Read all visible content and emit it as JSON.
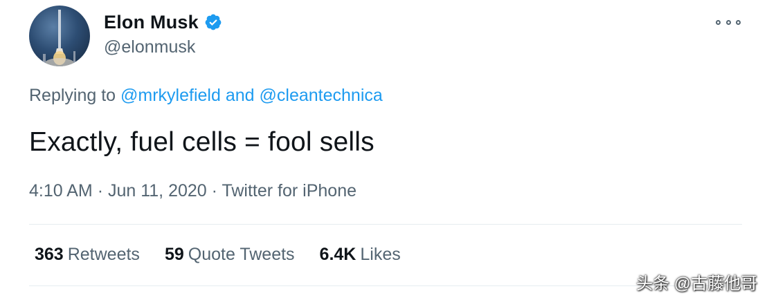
{
  "author": {
    "name": "Elon Musk",
    "handle": "@elonmusk",
    "verified": true,
    "avatar_icon": "rocket-launch-avatar",
    "verified_icon": "verified-badge-icon"
  },
  "more_icon": "more-options-icon",
  "reply": {
    "prefix": "Replying to",
    "mention1": "@mrkylefield",
    "conjunction": "and",
    "mention2": "@cleantechnica"
  },
  "tweet": {
    "text": "Exactly, fuel cells = fool sells"
  },
  "meta": {
    "time": "4:10 AM",
    "separator": "·",
    "date": "Jun 11, 2020",
    "source": "Twitter for iPhone"
  },
  "stats": [
    {
      "count": "363",
      "label": "Retweets"
    },
    {
      "count": "59",
      "label": "Quote Tweets"
    },
    {
      "count": "6.4K",
      "label": "Likes"
    }
  ],
  "watermark": "头条 @古藤他哥",
  "colors": {
    "link": "#1d9bf0",
    "secondary_text": "#536471",
    "primary_text": "#0f1419",
    "divider": "#e6ecf0"
  }
}
